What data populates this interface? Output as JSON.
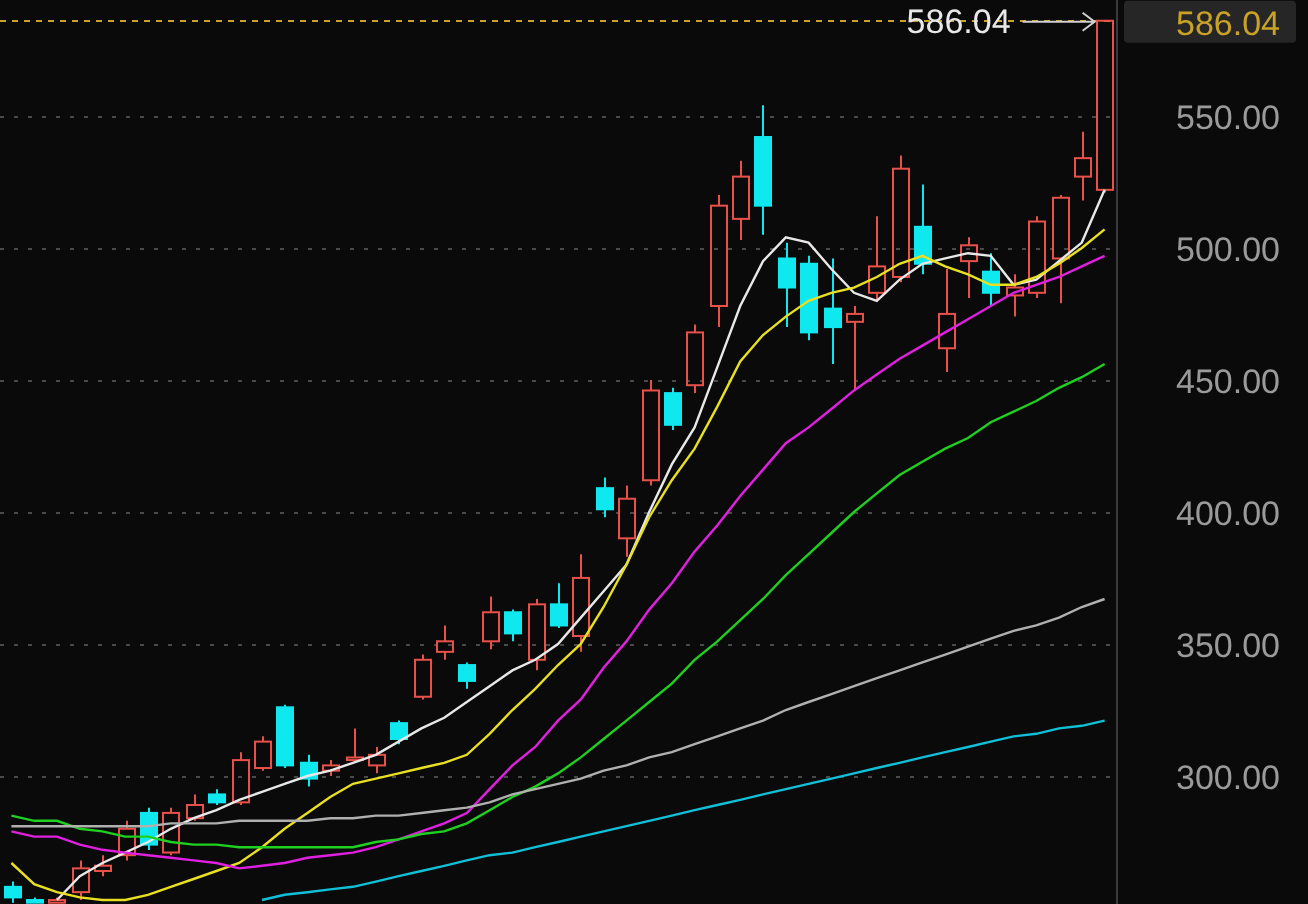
{
  "chart_data": {
    "type": "candlestick",
    "grid": true,
    "ylim": [
      251.5,
      593.9
    ],
    "yticks": [
      {
        "value": 300,
        "label": "300.00"
      },
      {
        "value": 350,
        "label": "350.00"
      },
      {
        "value": 400,
        "label": "400.00"
      },
      {
        "value": 450,
        "label": "450.00"
      },
      {
        "value": 500,
        "label": "500.00"
      },
      {
        "value": 550,
        "label": "550.00"
      }
    ],
    "ohlc": [
      [
        258,
        260,
        252,
        254
      ],
      [
        253,
        254,
        252,
        252
      ],
      [
        252,
        254,
        252,
        253
      ],
      [
        256,
        268,
        253,
        265
      ],
      [
        264,
        270,
        262,
        266
      ],
      [
        270,
        283,
        268,
        280
      ],
      [
        286,
        288,
        272,
        274
      ],
      [
        271,
        288,
        270,
        286
      ],
      [
        284,
        293,
        283,
        289
      ],
      [
        293,
        295,
        289,
        290
      ],
      [
        290,
        309,
        289,
        306
      ],
      [
        303,
        315,
        302,
        313
      ],
      [
        326,
        327,
        303,
        304
      ],
      [
        305,
        308,
        296,
        299
      ],
      [
        302,
        306,
        300,
        304
      ],
      [
        306,
        318,
        305,
        307
      ],
      [
        304,
        311,
        301,
        308
      ],
      [
        320,
        321,
        312,
        314
      ],
      [
        330,
        346,
        329,
        344
      ],
      [
        347,
        357,
        344,
        351
      ],
      [
        342,
        343,
        333,
        336
      ],
      [
        351,
        368,
        348,
        362
      ],
      [
        362,
        363,
        351,
        354
      ],
      [
        344,
        367,
        340,
        365
      ],
      [
        365,
        373,
        356,
        357
      ],
      [
        353,
        384,
        347,
        375
      ],
      [
        409,
        413,
        398,
        401
      ],
      [
        390,
        410,
        383,
        405
      ],
      [
        412,
        450,
        410,
        446
      ],
      [
        445,
        447,
        431,
        433
      ],
      [
        448,
        471,
        445,
        468
      ],
      [
        478,
        520,
        470,
        516
      ],
      [
        511,
        533,
        503,
        527
      ],
      [
        542,
        554,
        505,
        516
      ],
      [
        496,
        502,
        470,
        485
      ],
      [
        494,
        497,
        465,
        468
      ],
      [
        477,
        496,
        456,
        470
      ],
      [
        472,
        478,
        446,
        475
      ],
      [
        483,
        512,
        480,
        493
      ],
      [
        489,
        535,
        487,
        530
      ],
      [
        508,
        524,
        490,
        494
      ],
      [
        462,
        492,
        453,
        475
      ],
      [
        495,
        504,
        481,
        501
      ],
      [
        491,
        498,
        478,
        483
      ],
      [
        482,
        490,
        474,
        485
      ],
      [
        483,
        512,
        481,
        510
      ],
      [
        496,
        520,
        479,
        519
      ],
      [
        527,
        544,
        518,
        534
      ],
      [
        522,
        586.04,
        521,
        586.04
      ]
    ],
    "series": [
      {
        "type": "line",
        "color": "#e8e8e8",
        "values": [
          null,
          null,
          253,
          262,
          267,
          271,
          275,
          280,
          284,
          287,
          291,
          294,
          297,
          300,
          302,
          305,
          308,
          313,
          318,
          322,
          328,
          334,
          340,
          344,
          350,
          360,
          370,
          380,
          400,
          418,
          432,
          455,
          478,
          495,
          504,
          502,
          492,
          483,
          480,
          488,
          494,
          496,
          498,
          497,
          486,
          488,
          495,
          502,
          522
        ]
      },
      {
        "type": "line",
        "color": "#e8e020",
        "values": [
          267,
          259,
          256,
          254,
          253,
          253,
          255,
          258,
          261,
          264,
          267,
          273,
          280,
          286,
          292,
          297,
          299,
          301,
          303,
          305,
          308,
          316,
          325,
          333,
          342,
          350,
          364,
          380,
          398,
          412,
          424,
          440,
          457,
          467,
          474,
          480,
          483,
          485,
          489,
          494,
          497,
          493,
          490,
          486,
          486,
          489,
          494,
          500,
          507
        ]
      },
      {
        "type": "line",
        "color": "#e020e0",
        "values": [
          279,
          277,
          277,
          274,
          272,
          271,
          270,
          269,
          268,
          267,
          265,
          266,
          267,
          269,
          270,
          271,
          273,
          276,
          279,
          282,
          286,
          295,
          304,
          311,
          321,
          329,
          341,
          351,
          363,
          373,
          385,
          395,
          406,
          416,
          426,
          432,
          439,
          446,
          452,
          458,
          463,
          468,
          473,
          478,
          483,
          486,
          489,
          493,
          497
        ]
      },
      {
        "type": "line",
        "color": "#20d020",
        "values": [
          285,
          283,
          283,
          280,
          279,
          277,
          277,
          275,
          274,
          274,
          273,
          273,
          273,
          273,
          273,
          273,
          275,
          276,
          278,
          279,
          282,
          287,
          292,
          296,
          301,
          307,
          314,
          321,
          328,
          335,
          344,
          351,
          359,
          367,
          376,
          384,
          392,
          400,
          407,
          414,
          419,
          424,
          428,
          434,
          438,
          442,
          447,
          451,
          456
        ]
      },
      {
        "type": "line",
        "color": "#b0b0b0",
        "values": [
          281,
          281,
          281,
          281,
          281,
          281,
          281,
          282,
          282,
          282,
          283,
          283,
          283,
          283,
          284,
          284,
          285,
          285,
          286,
          287,
          288,
          290,
          293,
          295,
          297,
          299,
          302,
          304,
          307,
          309,
          312,
          315,
          318,
          321,
          325,
          328,
          331,
          334,
          337,
          340,
          343,
          346,
          349,
          352,
          355,
          357,
          360,
          364,
          367
        ]
      },
      {
        "type": "line",
        "color": "#10c0d8",
        "values": [
          null,
          null,
          null,
          null,
          null,
          null,
          null,
          null,
          null,
          null,
          null,
          253,
          255,
          256,
          257,
          258,
          260,
          262,
          264,
          266,
          268,
          270,
          271,
          273,
          275,
          277,
          279,
          281,
          283,
          285,
          287,
          289,
          291,
          293,
          295,
          297,
          299,
          301,
          303,
          305,
          307,
          309,
          311,
          313,
          315,
          316,
          318,
          319,
          321
        ]
      }
    ],
    "ref_lines": [
      {
        "axis": "y",
        "value": 586.04,
        "label": "586.04"
      }
    ],
    "annotations": [
      "586.04"
    ]
  }
}
